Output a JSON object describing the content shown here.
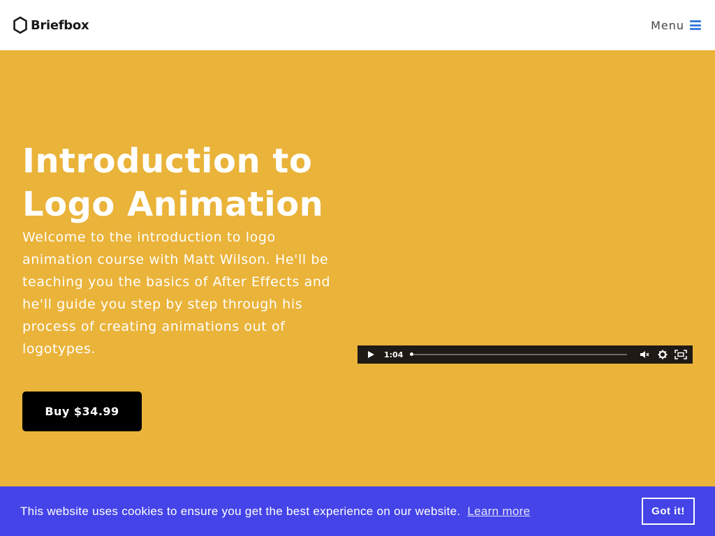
{
  "header": {
    "brand": "Briefbox",
    "menu_label": "Menu"
  },
  "hero": {
    "title": "Introduction to Logo Animation",
    "description": "Welcome to the introduction to logo animation course with Matt Wilson. He'll be teaching you the basics of After Effects and he'll guide you step by step through his process of creating animations out of logotypes.",
    "buy_label": "Buy $34.99"
  },
  "player": {
    "time": "1:04",
    "progress": 0,
    "icons": [
      "play-icon",
      "volume-icon",
      "settings-icon",
      "fullscreen-icon"
    ]
  },
  "cookie": {
    "message": "This website uses cookies to ensure you get the best experience on our website.",
    "link_label": "Learn more",
    "button_label": "Got it!"
  },
  "colors": {
    "hero_background": "#eab339",
    "cookie_background": "#4444e8",
    "menu_icon": "#3b7ddd",
    "player_background": "#1f1a16"
  }
}
